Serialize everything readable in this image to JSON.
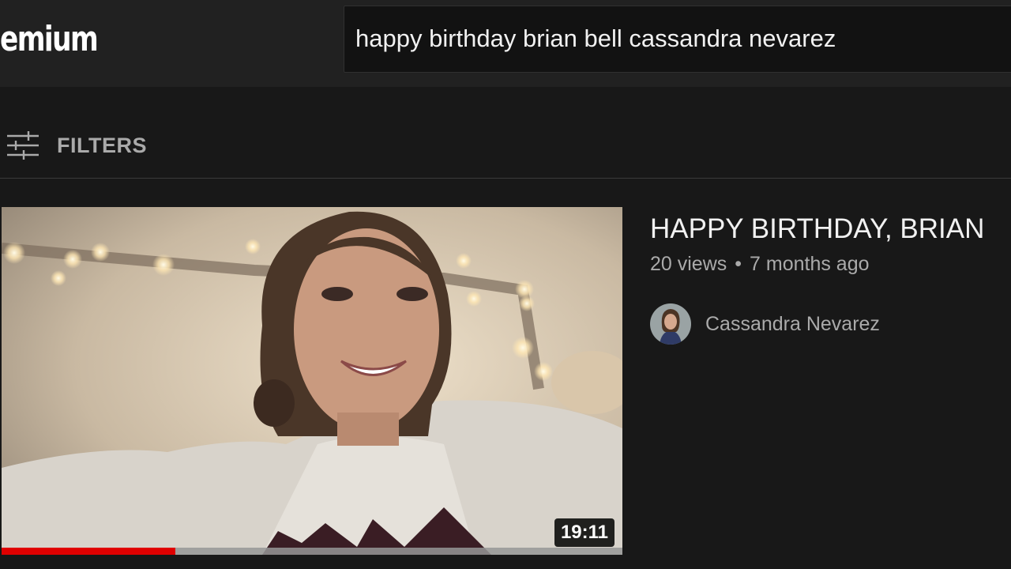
{
  "masthead": {
    "logo_text": "emium",
    "search": {
      "value": "happy birthday brian bell cassandra nevarez"
    }
  },
  "filters": {
    "label": "FILTERS",
    "icon": "filters-sliders-icon"
  },
  "result": {
    "title": "HAPPY BIRTHDAY, BRIAN",
    "views": "20 views",
    "separator": "•",
    "age": "7 months ago",
    "channel": "Cassandra Nevarez",
    "duration": "19:11",
    "watch_progress": 0.28
  },
  "colors": {
    "background": "#181818",
    "masthead": "#212121",
    "progress": "#e00000",
    "secondary_text": "#aaaaaa"
  }
}
